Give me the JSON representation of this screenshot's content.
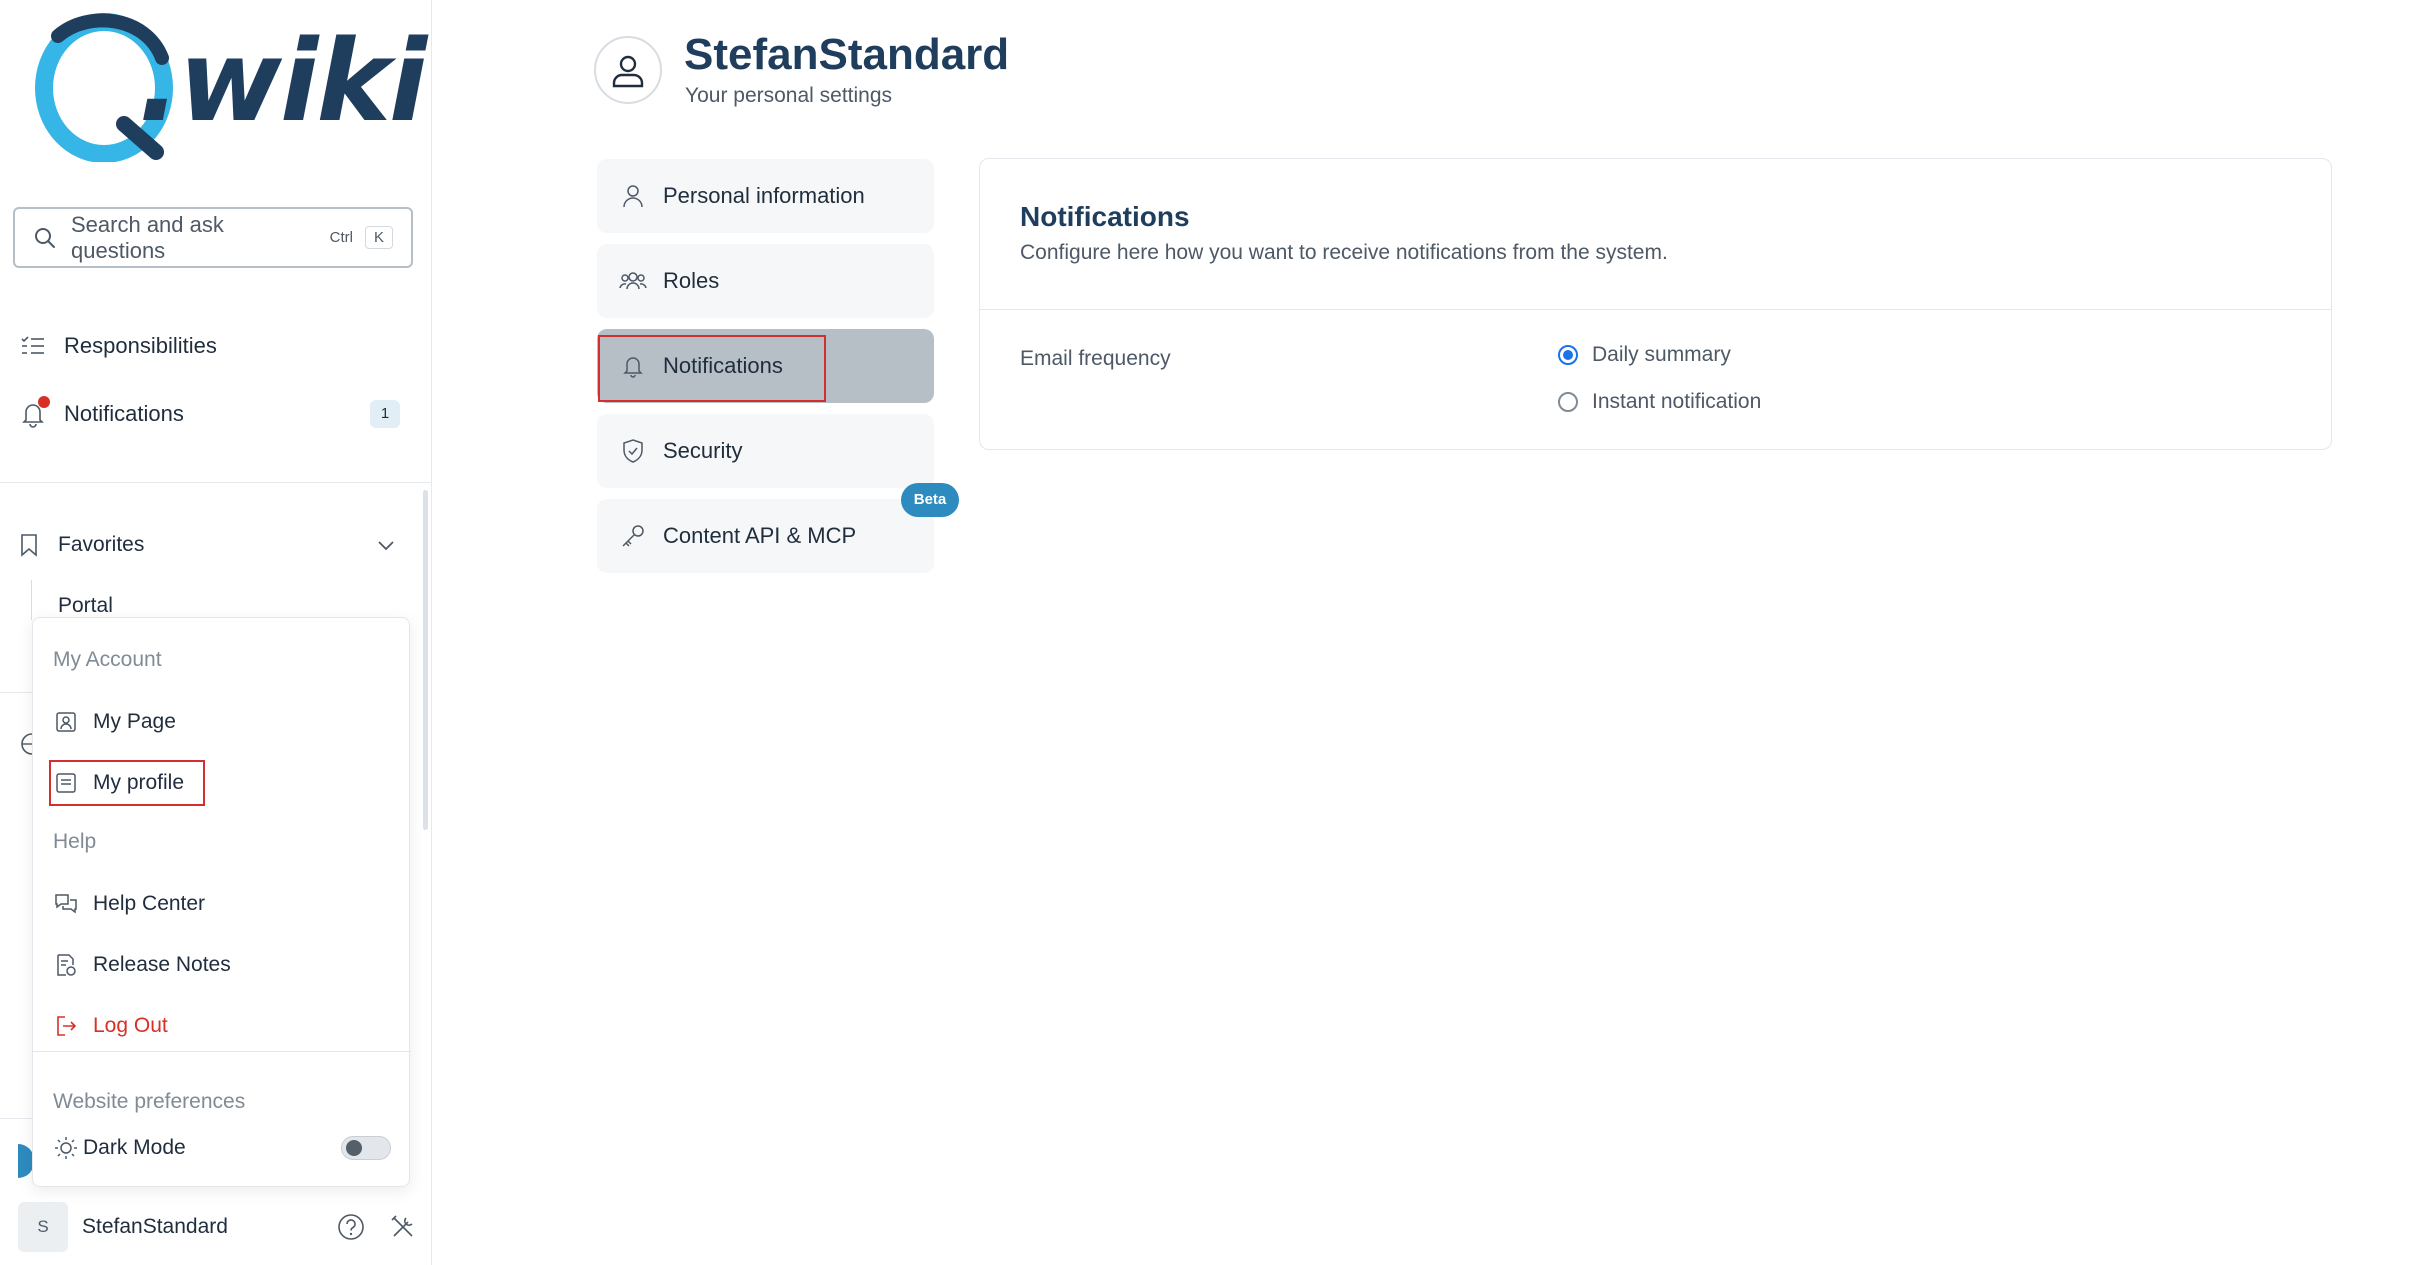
{
  "app": {
    "logo_text": ".wiki",
    "logo_mark_letter": "Q"
  },
  "sidebar": {
    "search": {
      "placeholder": "Search and ask questions",
      "shortcut_mod": "Ctrl",
      "shortcut_key": "K"
    },
    "items": [
      {
        "label": "Responsibilities",
        "icon": "list-check-icon"
      },
      {
        "label": "Notifications",
        "icon": "bell-icon",
        "count": "1"
      }
    ],
    "favorites": {
      "label": "Favorites",
      "items": [
        "Portal"
      ]
    }
  },
  "account_menu": {
    "section_account": "My Account",
    "my_page": "My Page",
    "my_profile": "My profile",
    "section_help": "Help",
    "help_center": "Help Center",
    "release_notes": "Release Notes",
    "logout": "Log Out",
    "section_prefs": "Website preferences",
    "dark_mode": "Dark Mode"
  },
  "user": {
    "initial": "S",
    "name": "StefanStandard"
  },
  "main": {
    "title": "StefanStandard",
    "subtitle": "Your personal settings",
    "tabs": [
      {
        "label": "Personal information",
        "icon": "person-icon"
      },
      {
        "label": "Roles",
        "icon": "people-icon"
      },
      {
        "label": "Notifications",
        "icon": "bell-icon",
        "active": true
      },
      {
        "label": "Security",
        "icon": "shield-icon"
      },
      {
        "label": "Content API & MCP",
        "icon": "key-icon",
        "badge": "Beta"
      }
    ],
    "panel": {
      "title": "Notifications",
      "description": "Configure here how you want to receive notifications from the system.",
      "email_label": "Email frequency",
      "options": [
        {
          "label": "Daily summary",
          "checked": true
        },
        {
          "label": "Instant notification",
          "checked": false
        }
      ]
    }
  },
  "colors": {
    "brand": "#1f3d5c",
    "accent": "#2e8bc0",
    "logo_swirl": "#35b6e6",
    "alert": "#d93025",
    "highlight": "#d32f2f",
    "radio": "#1a73e8"
  }
}
